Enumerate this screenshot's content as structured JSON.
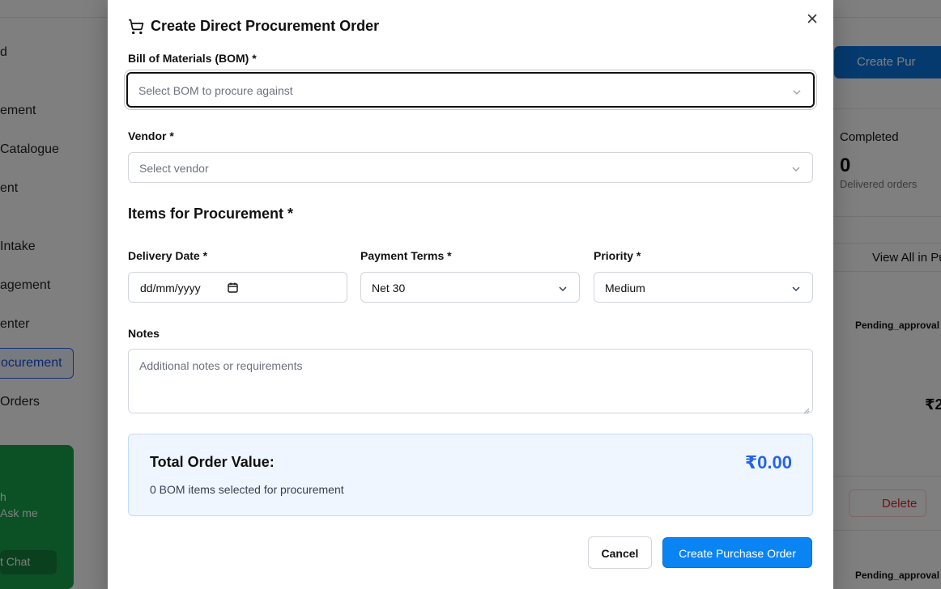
{
  "background": {
    "sidebar": {
      "items": [
        "d",
        "ement",
        "Catalogue",
        "ent",
        "Intake",
        "agement",
        "enter",
        "ocurement",
        "Orders"
      ],
      "active_label": "ocurement",
      "chat": {
        "line1": "h",
        "line2": "Ask me",
        "button": "t Chat"
      }
    },
    "create_button": "Create Pur",
    "completed_card": {
      "title": "Completed",
      "value": "0",
      "subtitle": "Delivered orders"
    },
    "view_all": "View All in Pu",
    "pending_badges": [
      "Pending_approval",
      "Pending_approval"
    ],
    "amount_partial": "₹2",
    "delete_button": "Delete"
  },
  "modal": {
    "title": "Create Direct Procurement Order",
    "bom": {
      "label": "Bill of Materials (BOM) *",
      "placeholder": "Select BOM to procure against"
    },
    "vendor": {
      "label": "Vendor *",
      "placeholder": "Select vendor"
    },
    "items_section_title": "Items for Procurement *",
    "delivery_date": {
      "label": "Delivery Date *",
      "value": "dd/mm/yyyy"
    },
    "payment_terms": {
      "label": "Payment Terms *",
      "value": "Net 30"
    },
    "priority": {
      "label": "Priority *",
      "value": "Medium"
    },
    "notes": {
      "label": "Notes",
      "placeholder": "Additional notes or requirements"
    },
    "total": {
      "label": "Total Order Value:",
      "value": "₹0.00",
      "subtitle": "0 BOM items selected for procurement"
    },
    "cancel_label": "Cancel",
    "submit_label": "Create Purchase Order"
  },
  "colors": {
    "primary": "#0b84f3",
    "accent_text": "#2563eb",
    "summary_bg": "#eff6ff"
  }
}
